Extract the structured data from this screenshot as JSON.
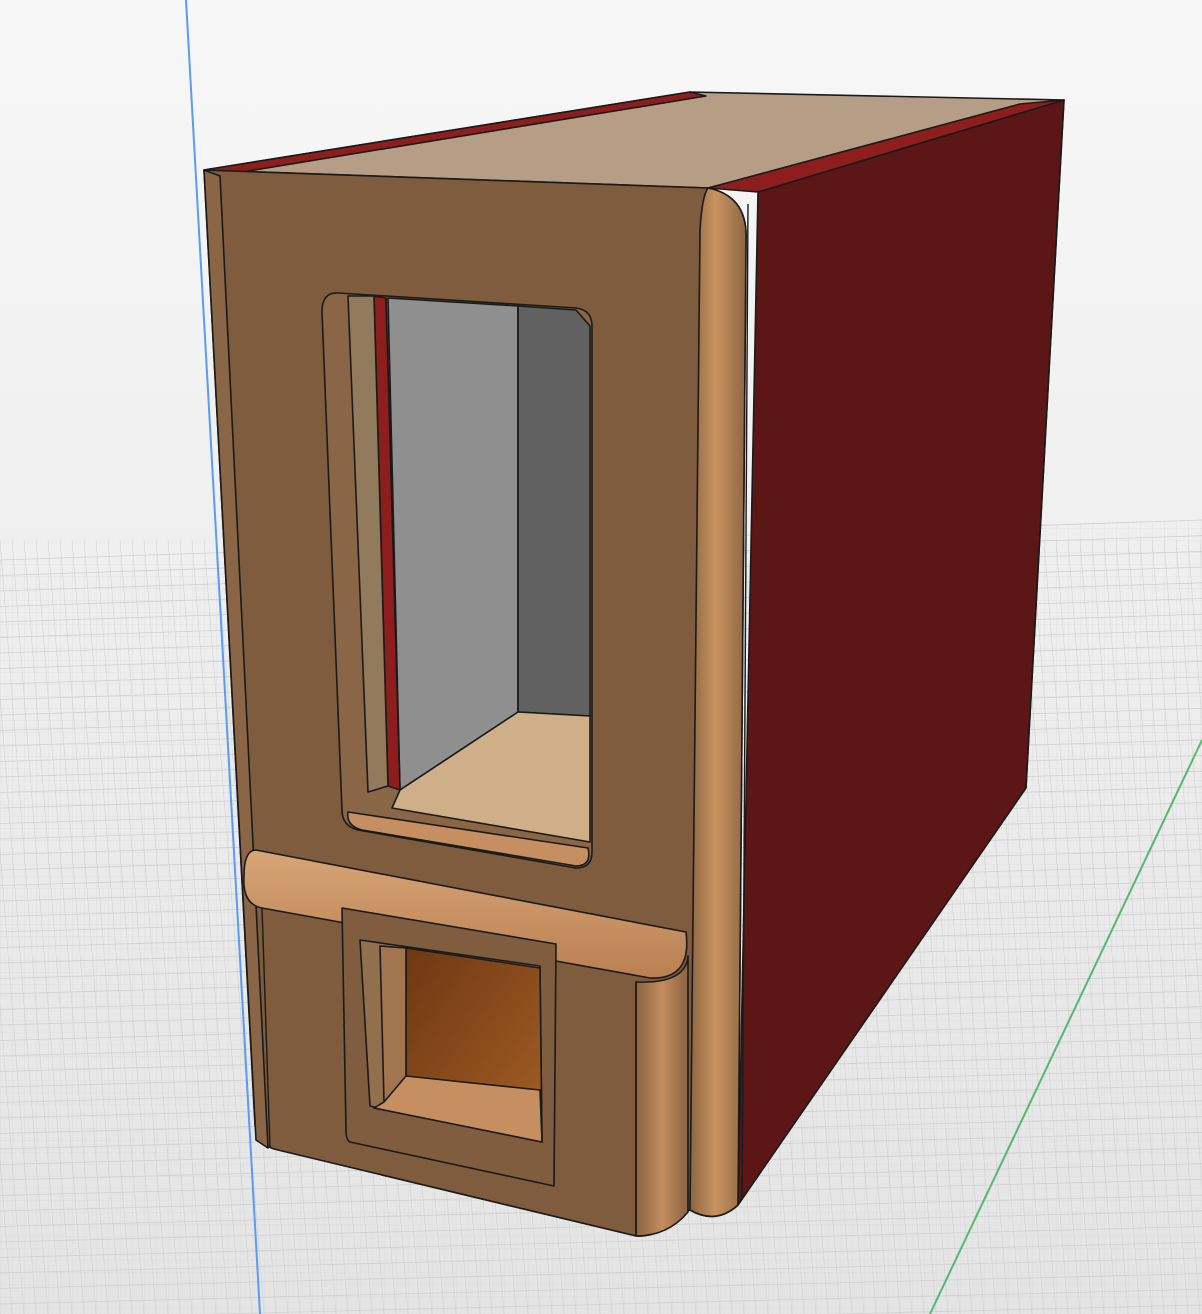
{
  "viewport": {
    "background_top": "#f7f7f7",
    "background_bottom": "#e4e4e4",
    "grid_color": "#cfcfcf",
    "axis_vertical_color": "#5b9bf0",
    "axis_ground_color": "#54b96e"
  },
  "model": {
    "name": "dispenser-cabinet",
    "colors": {
      "front_face": "#7e5c3d",
      "side_face": "#5c1616",
      "top_face": "#b69d86",
      "top_edge_red": "#8e1e1e",
      "rounded_edge": "#c08a5c",
      "cavity_back_wall": "#8f8f8f",
      "cavity_side_wall": "#616161",
      "cavity_floor": "#cfaf88",
      "shelf": "#c68f62",
      "lower_cavity": "#82451a",
      "outline": "#1a1a1a"
    }
  }
}
